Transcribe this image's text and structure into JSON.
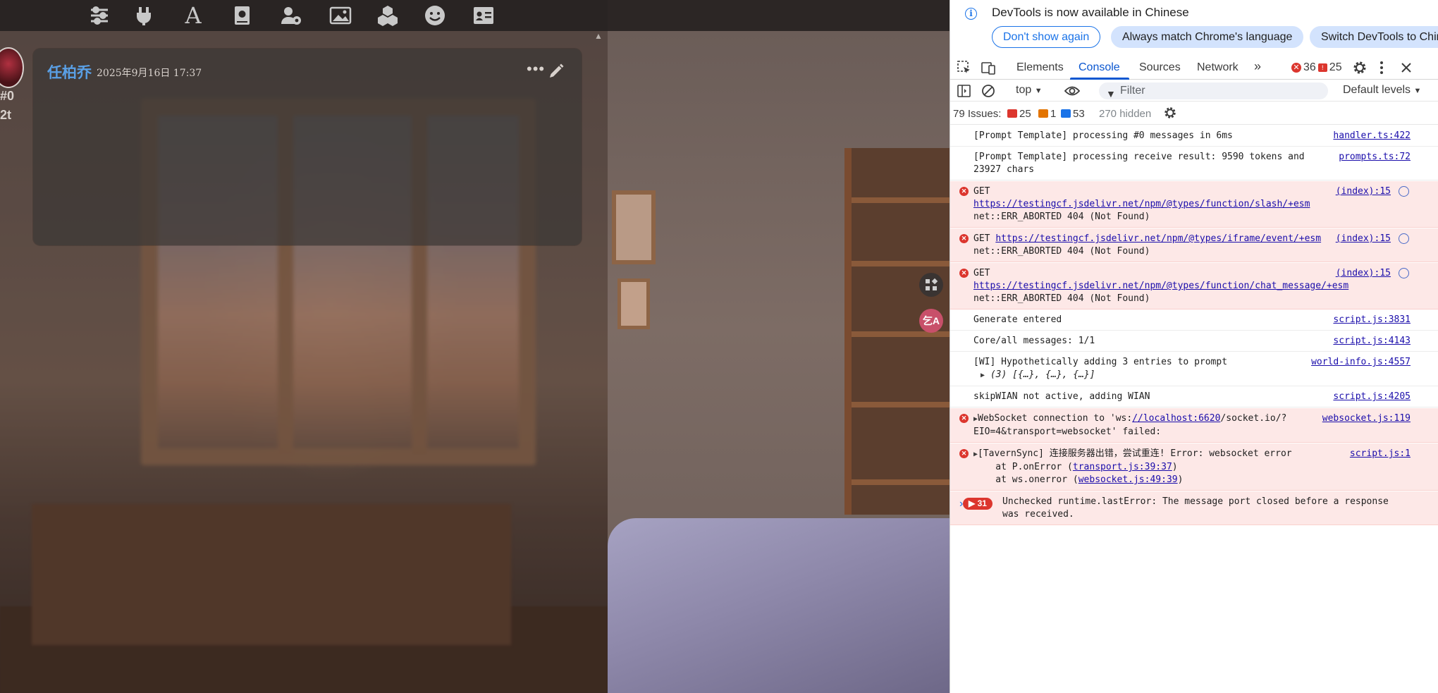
{
  "app": {
    "message": {
      "author": "任柏乔",
      "timestamp": "2025年9月16日 17:37",
      "id_label": "#0",
      "tokens_label": "2t",
      "more_label": "•••"
    },
    "scroll_up_label": "▲",
    "side_badge_label": "⛀",
    "side_avatar_label": "乞A"
  },
  "devtools": {
    "info": {
      "text": "DevTools is now available in Chinese",
      "btn_dont_show": "Don't show again",
      "btn_match": "Always match Chrome's language",
      "btn_switch": "Switch DevTools to Chin"
    },
    "tabs": [
      "Elements",
      "Console",
      "Sources",
      "Network"
    ],
    "error_count": "36",
    "warning_count": "25",
    "context": "top",
    "filter_placeholder": "Filter",
    "levels": "Default levels",
    "issues": {
      "label": "79 Issues:",
      "errors": "25",
      "warnings": "1",
      "info": "53",
      "hidden": "270 hidden"
    },
    "rows": [
      {
        "text": "[Prompt Template] processing #0 messages in 6ms",
        "src": "handler.ts:422"
      },
      {
        "text": "[Prompt Template] processing receive result: 9590 tokens and 23927 chars",
        "src": "prompts.ts:72"
      },
      {
        "pre": "GET",
        "link": "https://testingcf.jsdelivr.net/npm/@types/function/slash/+esm",
        "post": "net::ERR_ABORTED 404 (Not Found)",
        "src": "(index):15"
      },
      {
        "pre": "GET",
        "link": "https://testingcf.jsdelivr.net/npm/@types/iframe/event/+esm",
        "post": "net::ERR_ABORTED 404 (Not Found)",
        "src": "(index):15"
      },
      {
        "pre": "GET",
        "link": "https://testingcf.jsdelivr.net/npm/@types/function/chat_message/+esm",
        "post": "net::ERR_ABORTED 404 (Not Found)",
        "src": "(index):15"
      },
      {
        "text": "Generate entered",
        "src": "script.js:3831"
      },
      {
        "text": "Core/all messages: 1/1",
        "src": "script.js:4143"
      },
      {
        "text": "[WI] Hypothetically adding 3 entries to prompt",
        "sub": "(3) [{…}, {…}, {…}]",
        "src": "world-info.js:4557"
      },
      {
        "text": "skipWIAN not active, adding WIAN",
        "src": "script.js:4205"
      },
      {
        "pre": "WebSocket connection to 'ws:",
        "link": "//localhost:6620",
        "post": "/socket.io/?EIO=4&transport=websocket' failed:",
        "src": "websocket.js:119"
      },
      {
        "text": "[TavernSync] 连接服务器出错，尝试重连! Error: websocket error",
        "line2_pre": "    at P.onError (",
        "line2_link": "transport.js:39:37",
        "line3_pre": "    at ws.onerror (",
        "line3_link": "websocket.js:49:39",
        "close": ")",
        "src": "script.js:1"
      },
      {
        "count": "31",
        "text": "Unchecked runtime.lastError: The message port closed before a response was received."
      }
    ],
    "prompt_caret": "›"
  }
}
